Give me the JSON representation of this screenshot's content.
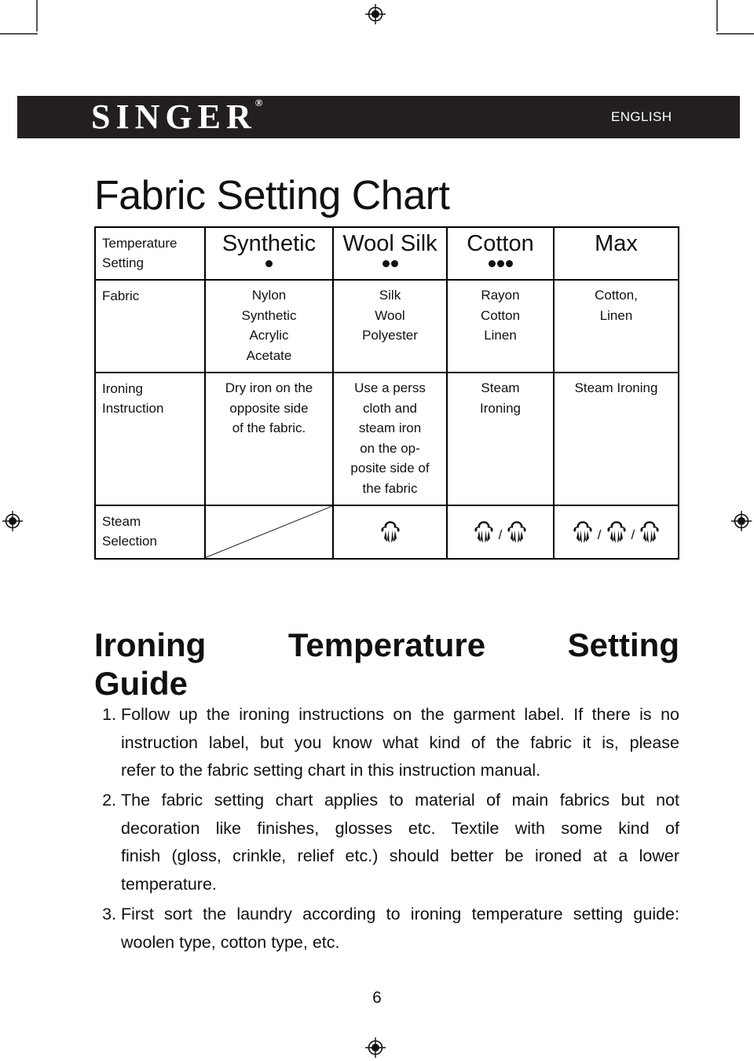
{
  "header": {
    "brand": "SINGER",
    "brand_trademark": "®",
    "language": "ENGLISH",
    "bar_color": "#231f20"
  },
  "page_title": "Fabric Setting Chart",
  "table": {
    "columns": [
      "",
      "Synthetic",
      "Wool Silk",
      "Cotton",
      "Max"
    ],
    "temperature_row": {
      "label_line1": "Temperature",
      "label_line2": "Setting",
      "dot_counts": [
        1,
        2,
        3,
        0
      ]
    },
    "fabric_row": {
      "label": "Fabric",
      "values": [
        "Nylon\nSynthetic\nAcrylic\nAcetate",
        "Silk\nWool\nPolyester",
        "Rayon\nCotton\nLinen",
        "Cotton,\nLinen"
      ]
    },
    "instruction_row": {
      "label_line1": "Ironing",
      "label_line2": "Instruction",
      "values": [
        "Dry iron on the\nopposite side\nof the fabric.",
        "Use a perss\ncloth and\nsteam iron\non the op-\nposite side of\nthe fabric",
        "Steam\nIroning",
        "Steam Ironing"
      ]
    },
    "steam_row": {
      "label_line1": "Steam",
      "label_line2": "Selection",
      "synthetic_cell": "diagonal-slash",
      "icon_counts": [
        0,
        1,
        2,
        3
      ],
      "separator": "/"
    }
  },
  "guide": {
    "heading_line1": "Ironing  Temperature  Setting",
    "heading_line2": "Guide",
    "items": [
      {
        "number": "1.",
        "lines": [
          "Follow up the ironing instructions on the garment label. If there is no",
          "instruction label, but you know what kind of the fabric it is, please",
          "refer to the fabric setting chart in this instruction manual."
        ]
      },
      {
        "number": "2.",
        "lines": [
          "The fabric setting chart applies to material of main fabrics but not",
          "decoration like finishes, glosses etc. Textile with some kind of",
          "finish (gloss, crinkle, relief etc.) should better be ironed at a lower",
          "temperature."
        ]
      },
      {
        "number": "3.",
        "lines": [
          "First sort the laundry according to ironing temperature setting guide:",
          "woolen type, cotton type, etc."
        ]
      }
    ]
  },
  "footer": {
    "page_number": "6"
  }
}
